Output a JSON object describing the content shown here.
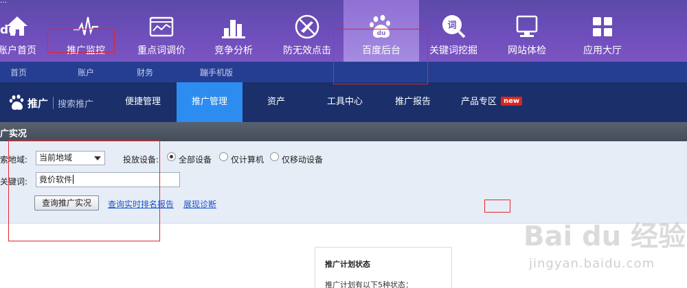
{
  "top_toolbar": {
    "truncated_title": "...",
    "tools": [
      {
        "label": "账户首页",
        "icon": "home-icon"
      },
      {
        "label": "推广监控",
        "icon": "pulse-icon"
      },
      {
        "label": "重点词调价",
        "icon": "chart-window-icon"
      },
      {
        "label": "竞争分析",
        "icon": "bar-chart-icon"
      },
      {
        "label": "防无效点击",
        "icon": "no-plane-icon"
      },
      {
        "label": "百度后台",
        "icon": "baidu-paw-icon",
        "active": true
      },
      {
        "label": "关键词挖掘",
        "icon": "word-magnifier-icon"
      },
      {
        "label": "网站体检",
        "icon": "monitor-icon"
      },
      {
        "label": "应用大厅",
        "icon": "grid-icon"
      }
    ]
  },
  "sub_nav": {
    "items": [
      "首页",
      "账户",
      "财务",
      "蹦手机版"
    ]
  },
  "product_nav": {
    "logo": {
      "du_text": "du",
      "brand": "推广",
      "subtitle": "搜索推广"
    },
    "items": [
      "便捷管理",
      "推广管理",
      "资产",
      "工具中心",
      "推广报告",
      "产品专区"
    ],
    "active_item": "推广管理",
    "new_badge": "new"
  },
  "section_header": {
    "title": "广实况"
  },
  "form": {
    "region_label": "索地域:",
    "region_value": "当前地域",
    "device_label": "投放设备:",
    "device_options": [
      "全部设备",
      "仅计算机",
      "仅移动设备"
    ],
    "device_selected": "全部设备",
    "keyword_label": "关键词:",
    "keyword_value": "竟价软件",
    "query_button": "查询推广实况",
    "links": [
      "查询实时排名报告",
      "展现诊断"
    ]
  },
  "status_card": {
    "title": "推广计划状态",
    "body": "推广计划有以下5种状态："
  },
  "watermark": {
    "brand": "Bai du 经验",
    "url": "jingyan.baidu.com"
  },
  "colors": {
    "toolbar_purple": "#6e4ebb",
    "subnav_blue": "#263e91",
    "product_nav_navy": "#1b2f6b",
    "active_tab_blue": "#2d8cf0",
    "link_blue": "#1d54c8",
    "annotation_red": "#e0262e"
  }
}
